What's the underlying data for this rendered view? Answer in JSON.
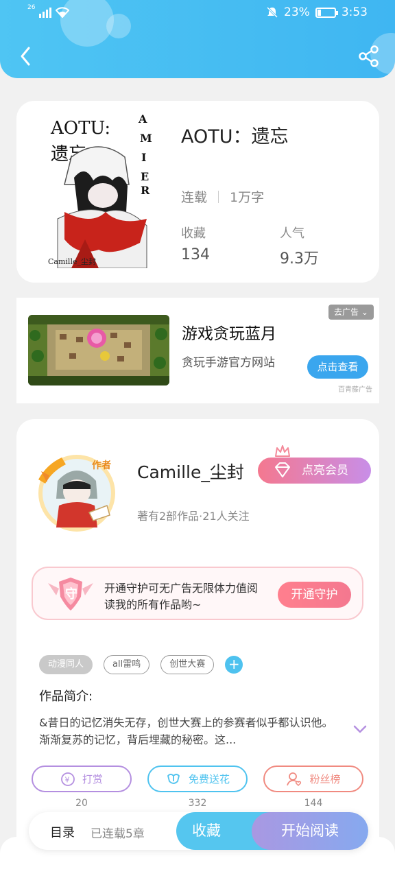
{
  "status_bar": {
    "network": "26",
    "battery": "23%",
    "time": "3:53",
    "battery_level": 0.23
  },
  "book": {
    "title": "AOTU：遗忘",
    "status": "连载",
    "word_count": "1万字",
    "fav_label": "收藏",
    "fav_value": "134",
    "pop_label": "人气",
    "pop_value": "9.3万",
    "cover_text": {
      "title_line1": "AOTU:",
      "title_line2": "遗忘",
      "vertical": [
        "A",
        "M",
        "I",
        "E",
        "R"
      ],
      "signature": "Camille_尘封"
    }
  },
  "ad": {
    "title": "游戏贪玩蓝月",
    "subtitle": "贪玩手游官方网站",
    "button": "点击查看",
    "tag": "去广告",
    "source": "百青藤广告"
  },
  "author": {
    "name": "Camille_尘封",
    "badge": "作者",
    "stats": "著有2部作品·21人关注",
    "vip_button": "点亮会员"
  },
  "guard": {
    "text": "开通守护可无广告无限体力值阅读我的所有作品哟~",
    "button": "开通守护",
    "badge_char": "守"
  },
  "tags": [
    "动漫同人",
    "all雷鸣",
    "创世大赛"
  ],
  "tag_add": "+",
  "intro": {
    "label": "作品简介:",
    "text": "&昔日的记忆消失无存，创世大赛上的参赛者似乎都认识他。渐渐复苏的记忆，背后埋藏的秘密。这..."
  },
  "actions": [
    {
      "label": "打赏",
      "count": "20",
      "color": "#b48fe0",
      "icon": "yen-icon"
    },
    {
      "label": "免费送花",
      "count": "332",
      "color": "#4fc3ef",
      "icon": "flower-icon"
    },
    {
      "label": "粉丝榜",
      "count": "144",
      "color": "#f08a80",
      "icon": "fans-icon"
    }
  ],
  "bottom_bar": {
    "toc": "目录",
    "serial": "已连载5章",
    "favorite": "收藏",
    "start_reading": "开始阅读"
  },
  "colors": {
    "header": "#45bdf3",
    "accent_pink": "#f4788f",
    "accent_blue": "#55c6ef"
  }
}
